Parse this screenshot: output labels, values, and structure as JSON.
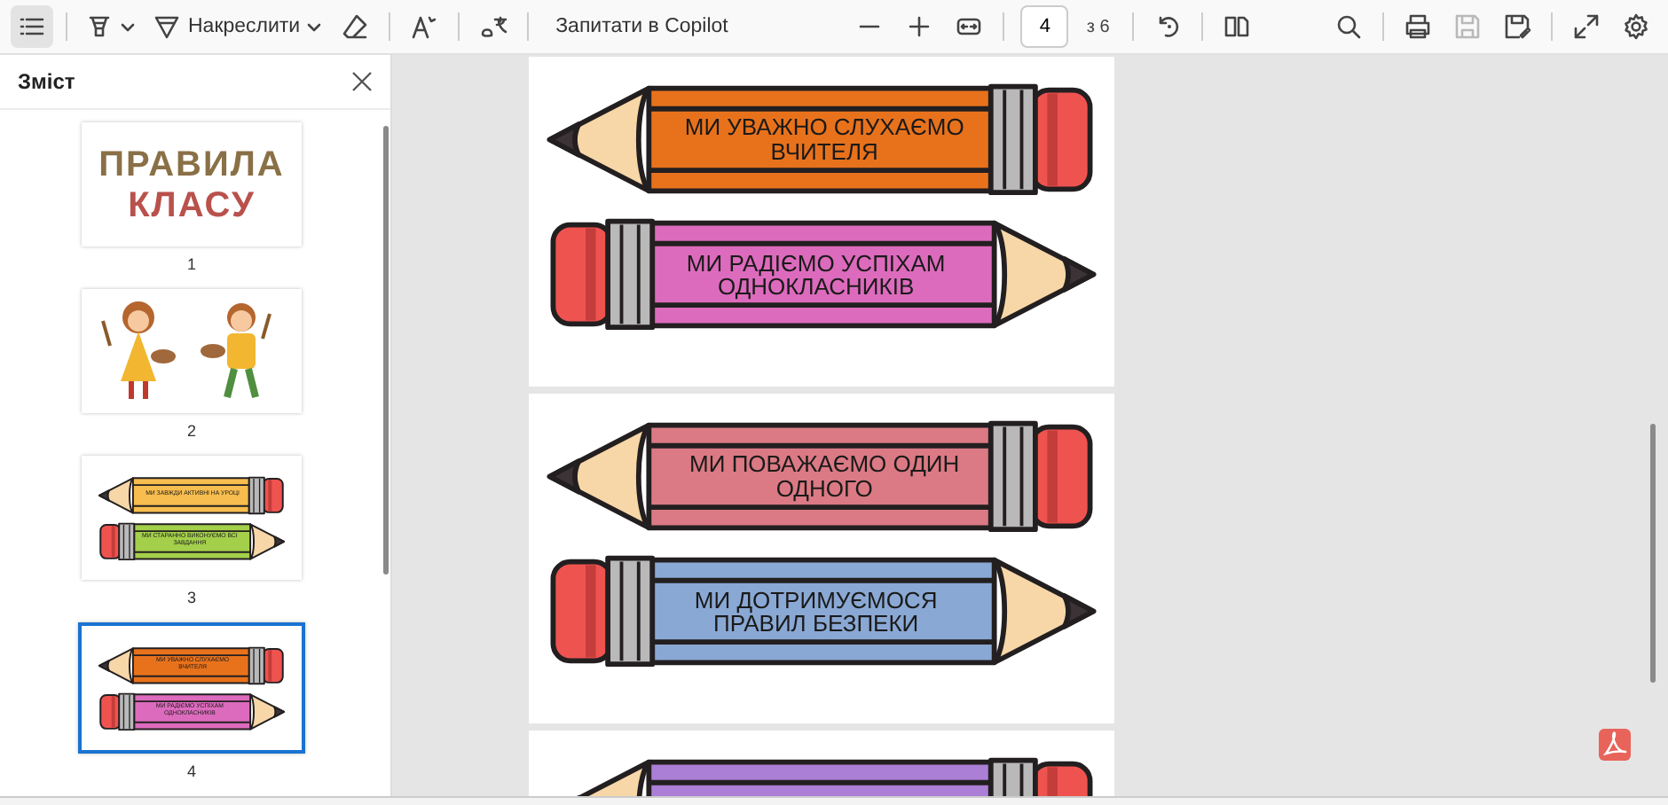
{
  "toolbar": {
    "contents_on": true,
    "draw_label": "Накреслити",
    "copilot_label": "Запитати в Copilot",
    "page_input": "4",
    "page_total": "з 6",
    "save_disabled": true
  },
  "sidebar": {
    "title": "Зміст",
    "thumbnails": [
      {
        "label": "1",
        "selected": false,
        "kind": "title",
        "lines": [
          "ПРАВИЛА",
          "КЛАСУ"
        ]
      },
      {
        "label": "2",
        "selected": false,
        "kind": "picture"
      },
      {
        "label": "3",
        "selected": false,
        "kind": "pencils",
        "pencils": [
          {
            "kind": "point-left",
            "color": "#f7bd4e",
            "text": "МИ ЗАВЖДИ АКТИВНІ НА УРОЦІ"
          },
          {
            "kind": "point-right",
            "color": "#a3cf4a",
            "text": "МИ СТАРАННО ВИКОНУЄМО ВСІ ЗАВДАННЯ"
          }
        ]
      },
      {
        "label": "4",
        "selected": true,
        "kind": "pencils",
        "pencils": [
          {
            "kind": "point-left",
            "color": "#e8721c",
            "text": "МИ УВАЖНО СЛУХАЄМО ВЧИТЕЛЯ"
          },
          {
            "kind": "point-right",
            "color": "#dd6bbd",
            "text": "МИ РАДІЄМО УСПІХАМ ОДНОКЛАСНИКІВ"
          }
        ]
      }
    ]
  },
  "pages": [
    {
      "pencils": [
        {
          "kind": "point-left",
          "color": "#e8721c",
          "text": "МИ УВАЖНО СЛУХАЄМО ВЧИТЕЛЯ"
        },
        {
          "kind": "point-right",
          "color": "#dd6bbd",
          "text": "МИ РАДІЄМО УСПІХАМ ОДНОКЛАСНИКІВ"
        }
      ]
    },
    {
      "pencils": [
        {
          "kind": "point-left",
          "color": "#db7a84",
          "text": "МИ ПОВАЖАЄМО ОДИН ОДНОГО"
        },
        {
          "kind": "point-right",
          "color": "#8aa8d4",
          "text": "МИ ДОТРИМУЄМОСЯ ПРАВИЛ БЕЗПЕКИ"
        }
      ]
    },
    {
      "pencils": [
        {
          "kind": "point-left",
          "color": "#ab7fd6"
        }
      ]
    }
  ]
}
